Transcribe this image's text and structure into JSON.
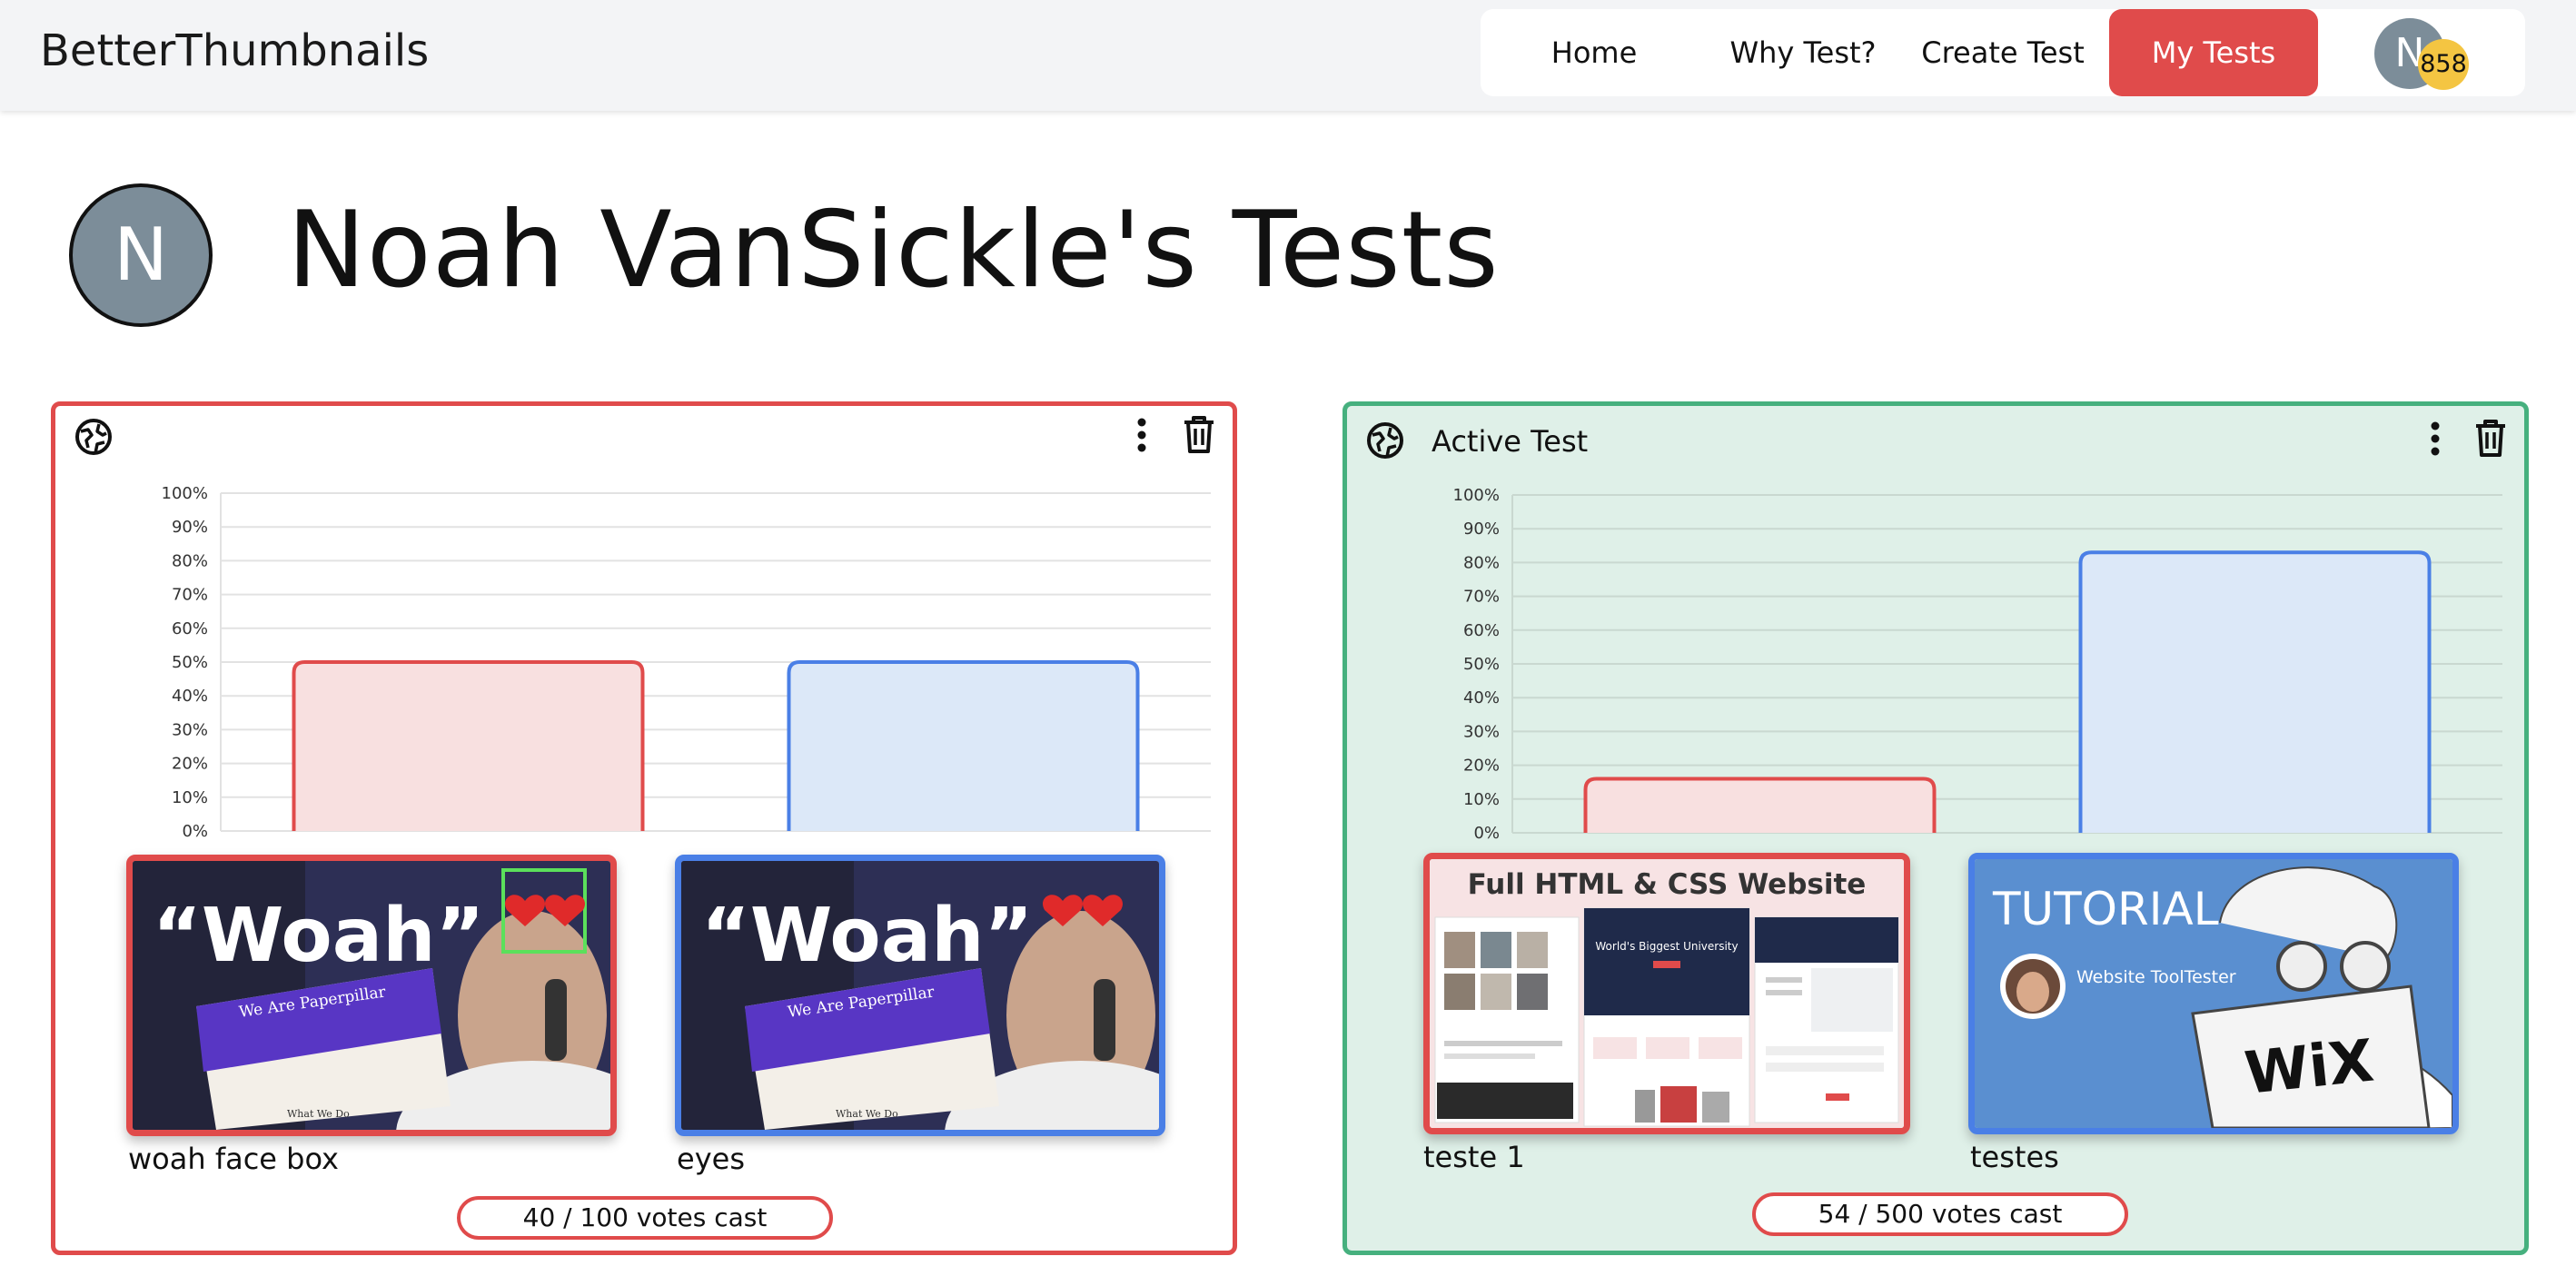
{
  "header": {
    "brand": "BetterThumbnails",
    "nav": [
      {
        "label": "Home"
      },
      {
        "label": "Why Test?"
      },
      {
        "label": "Create Test"
      },
      {
        "label": "My Tests"
      }
    ],
    "avatar_initial": "N",
    "points_badge": "858"
  },
  "page": {
    "avatar_initial": "N",
    "title": "Noah VanSickle's Tests"
  },
  "tests": [
    {
      "status_label": "",
      "active": false,
      "votes_text": "40 / 100 votes cast",
      "chart_data": {
        "type": "bar",
        "categories": [
          "woah face box",
          "eyes"
        ],
        "values": [
          50,
          50
        ],
        "y_ticks": [
          "0%",
          "10%",
          "20%",
          "30%",
          "40%",
          "50%",
          "60%",
          "70%",
          "80%",
          "90%",
          "100%"
        ],
        "ylim": [
          0,
          100
        ],
        "colors": [
          "#e04b4b",
          "#4a7fe6"
        ],
        "fills": [
          "#f8e0e0",
          "#dce8f8"
        ]
      },
      "thumbnails": [
        {
          "label": "woah face box",
          "text": "“Woah”",
          "sub": "We Are Paperpillar",
          "footer": "What We Do"
        },
        {
          "label": "eyes",
          "text": "“Woah”",
          "sub": "We Are Paperpillar",
          "footer": "What We Do"
        }
      ]
    },
    {
      "status_label": "Active Test",
      "active": true,
      "votes_text": "54 / 500 votes cast",
      "chart_data": {
        "type": "bar",
        "categories": [
          "teste 1",
          "testes"
        ],
        "values": [
          16,
          83
        ],
        "y_ticks": [
          "0%",
          "10%",
          "20%",
          "30%",
          "40%",
          "50%",
          "60%",
          "70%",
          "80%",
          "90%",
          "100%"
        ],
        "ylim": [
          0,
          100
        ],
        "colors": [
          "#e04b4b",
          "#4a7fe6"
        ],
        "fills": [
          "#f8e0e0",
          "#dce8f8"
        ]
      },
      "thumbnails": [
        {
          "label": "teste 1",
          "text": "Full HTML & CSS Website",
          "sub": "World's Biggest University"
        },
        {
          "label": "testes",
          "text": "TUTORIAL",
          "sub": "Website ToolTester",
          "footer": "WiX"
        }
      ]
    }
  ]
}
